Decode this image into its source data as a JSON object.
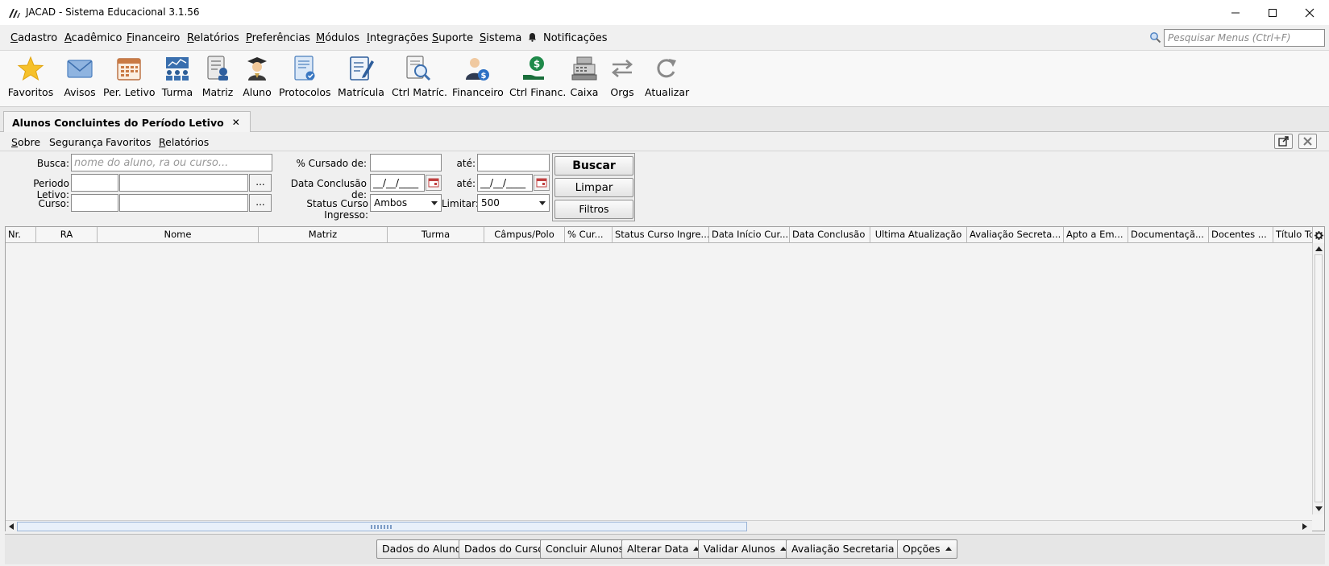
{
  "window": {
    "title": "JACAD - Sistema Educacional 3.1.56",
    "minimize": "—",
    "maximize": "☐",
    "close": "✕"
  },
  "menubar": {
    "items": [
      {
        "label": "Cadastro",
        "ul": "C",
        "rest": "adastro"
      },
      {
        "label": "Acadêmico",
        "ul": "A",
        "rest": "cadêmico"
      },
      {
        "label": "Financeiro",
        "ul": "F",
        "rest": "inanceiro"
      },
      {
        "label": "Relatórios",
        "ul": "R",
        "rest": "elatórios"
      },
      {
        "label": "Preferências",
        "ul": "P",
        "rest": "referências"
      },
      {
        "label": "Módulos",
        "ul": "M",
        "rest": "ódulos"
      },
      {
        "label": "Integrações",
        "ul": "I",
        "rest": "ntegrações"
      },
      {
        "label": "Suporte",
        "ul": "S",
        "rest": "uporte"
      },
      {
        "label": "Sistema",
        "ul": "S",
        "rest": "istema"
      }
    ],
    "notifications": "Notificações",
    "search_placeholder": "Pesquisar Menus (Ctrl+F)"
  },
  "toolbar": {
    "items": [
      "Favoritos",
      "Avisos",
      "Per. Letivo",
      "Turma",
      "Matriz",
      "Aluno",
      "Protocolos",
      "Matrícula",
      "Ctrl Matríc.",
      "Financeiro",
      "Ctrl Financ.",
      "Caixa",
      "Orgs",
      "Atualizar"
    ]
  },
  "tab": {
    "title": "Alunos Concluintes do Período Letivo",
    "close": "✕"
  },
  "submenu": {
    "items": [
      "Sobre",
      "Segurança",
      "Favoritos",
      "Relatórios"
    ]
  },
  "filters": {
    "busca_label": "Busca:",
    "busca_placeholder": "nome do aluno, ra ou curso...",
    "periodo_label": "Periodo Letivo:",
    "curso_label": "Curso:",
    "dots": "...",
    "cursado_label": "% Cursado de:",
    "ate_label": "até:",
    "conclusao_label": "Data Conclusão de:",
    "date_mask": "__/__/____",
    "status_label": "Status Curso Ingresso:",
    "status_value": "Ambos",
    "limitar_label": "Limitar:",
    "limitar_value": "500"
  },
  "buttons": {
    "buscar": "Buscar",
    "limpar": "Limpar",
    "filtros": "Filtros"
  },
  "table": {
    "columns": [
      "Nr.",
      "RA",
      "Nome",
      "Matriz",
      "Turma",
      "Câmpus/Polo",
      "% Cur...",
      "Status Curso Ingre...",
      "Data Início Cur...",
      "Data Conclusão",
      "Ultima Atualização",
      "Avaliação Secreta...",
      "Apto a Em...",
      "Documentaçã...",
      "Docentes ...",
      "Título To"
    ],
    "rows": []
  },
  "bottom": {
    "dados_aluno": "Dados do Aluno",
    "dados_curso": "Dados do Curso",
    "concluir": "Concluir Alunos",
    "alterar_data": "Alterar Data",
    "validar": "Validar Alunos",
    "avaliacao": "Avaliação Secretaria",
    "opcoes": "Opções"
  }
}
